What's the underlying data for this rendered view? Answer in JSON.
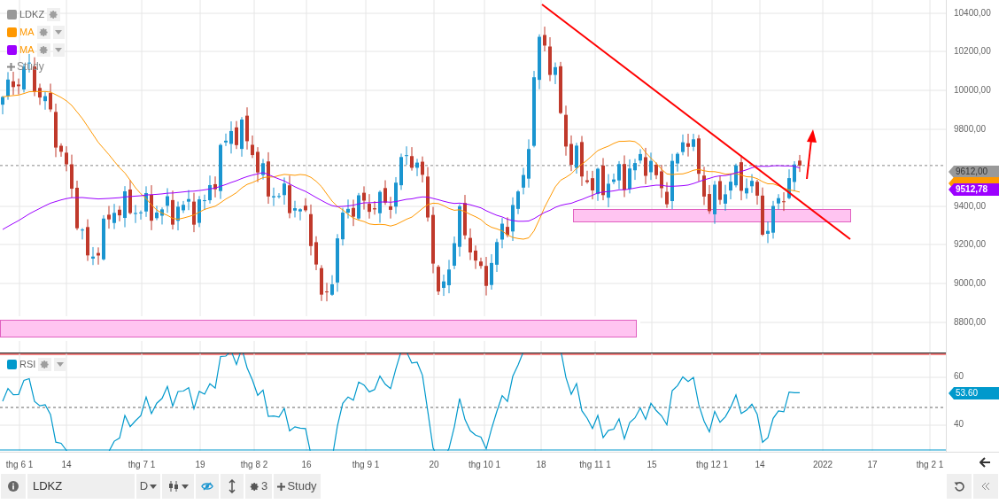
{
  "legend": [
    {
      "kind": "symbol",
      "label": "LDKZ",
      "color": "#999999"
    },
    {
      "kind": "indicator",
      "label": "MA",
      "color": "#ff9800"
    },
    {
      "kind": "indicator",
      "label": "MA",
      "color": "#9c00ff"
    }
  ],
  "add_study": "Study",
  "price_axis": [
    "10400,00",
    "10200,00",
    "10000,00",
    "9800,00",
    "9400,00",
    "9200,00",
    "9000,00",
    "8800,00"
  ],
  "price_tags": [
    {
      "kind": "last",
      "label": "9612,00",
      "color": "#999999"
    },
    {
      "kind": "hidden",
      "color": "#ff9800"
    },
    {
      "kind": "value",
      "label": "9512,78",
      "color": "#9c00ff"
    }
  ],
  "rsi": {
    "label": "RSI",
    "color": "#0099cc",
    "axis": [
      "60",
      "40"
    ],
    "tag": "53.60"
  },
  "time_axis": [
    "thg 6 1",
    "14",
    "thg 7 1",
    "19",
    "thg 8 2",
    "16",
    "thg 9 1",
    "20",
    "thg 10 1",
    "18",
    "thg 11 1",
    "15",
    "thg 12 1",
    "14",
    "2022",
    "17",
    "thg 2 1"
  ],
  "toolbar": {
    "symbol": "LDKZ",
    "interval": "D",
    "indicator_count": "3",
    "study": "Study"
  }
}
